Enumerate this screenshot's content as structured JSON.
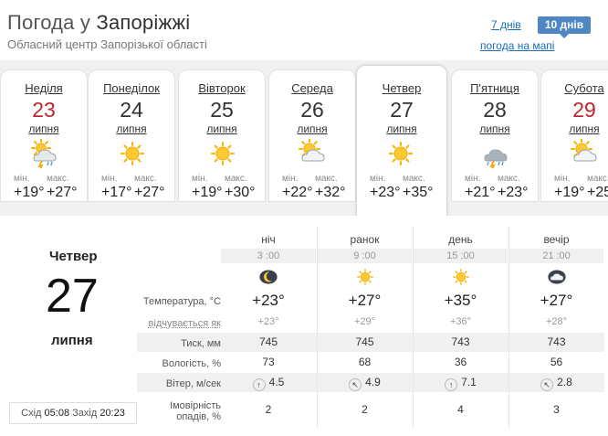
{
  "header": {
    "title_prefix": "Погода у ",
    "title_city": "Запоріжжі",
    "subtitle": "Обласний центр Запорізької області",
    "nav_7days": "7 днів",
    "nav_10days": "10 днів",
    "nav_map": "погода на мапі"
  },
  "days": [
    {
      "name": "Неділя",
      "num": "23",
      "month": "липня",
      "weekend": true,
      "icon": "storm-icon",
      "min_label": "мін.",
      "max_label": "макс.",
      "min": "+19°",
      "max": "+27°"
    },
    {
      "name": "Понеділок",
      "num": "24",
      "month": "липня",
      "weekend": false,
      "icon": "sun-icon",
      "min_label": "мін.",
      "max_label": "макс.",
      "min": "+17°",
      "max": "+27°"
    },
    {
      "name": "Вівторок",
      "num": "25",
      "month": "липня",
      "weekend": false,
      "icon": "sun-icon",
      "min_label": "мін.",
      "max_label": "макс.",
      "min": "+19°",
      "max": "+30°"
    },
    {
      "name": "Середа",
      "num": "26",
      "month": "липня",
      "weekend": false,
      "icon": "partly-cloudy-icon",
      "min_label": "мін.",
      "max_label": "макс.",
      "min": "+22°",
      "max": "+32°"
    },
    {
      "name": "Четвер",
      "num": "27",
      "month": "липня",
      "weekend": false,
      "icon": "sun-icon",
      "min_label": "мін.",
      "max_label": "макс.",
      "min": "+23°",
      "max": "+35°",
      "active": true
    },
    {
      "name": "П'ятниця",
      "num": "28",
      "month": "липня",
      "weekend": false,
      "icon": "thunderstorm-icon",
      "min_label": "мін.",
      "max_label": "макс.",
      "min": "+21°",
      "max": "+23°"
    },
    {
      "name": "Субота",
      "num": "29",
      "month": "липня",
      "weekend": true,
      "icon": "partly-cloudy-icon",
      "min_label": "мін.",
      "max_label": "макс.",
      "min": "+19°",
      "max": "+25"
    }
  ],
  "detail": {
    "day_name": "Четвер",
    "day_num": "27",
    "month": "липня",
    "sunrise_label": "Схід",
    "sunrise": "05:08",
    "sunset_label": "Захід",
    "sunset": "20:23",
    "row_labels": {
      "temp": "Температура, °C",
      "feels": "відчувається як",
      "pressure": "Тиск, мм",
      "humidity": "Вологість, %",
      "wind": "Вітер, м/сек",
      "precip_1": "Імовірність",
      "precip_2": "опадів, %"
    },
    "periods": [
      {
        "name": "ніч",
        "time": "3 :00",
        "icon": "moon-icon",
        "temp": "+23°",
        "feels": "+23°",
        "pressure": "745",
        "humidity": "73",
        "wind_dir": "↑",
        "wind": "4.5",
        "precip": "2"
      },
      {
        "name": "ранок",
        "time": "9 :00",
        "icon": "sun-icon",
        "temp": "+27°",
        "feels": "+29°",
        "pressure": "745",
        "humidity": "68",
        "wind_dir": "↖",
        "wind": "4.9",
        "precip": "2"
      },
      {
        "name": "день",
        "time": "15 :00",
        "icon": "sun-icon",
        "temp": "+35°",
        "feels": "+36°",
        "pressure": "743",
        "humidity": "36",
        "wind_dir": "↑",
        "wind": "7.1",
        "precip": "4"
      },
      {
        "name": "вечір",
        "time": "21 :00",
        "icon": "moon-cloud-icon",
        "temp": "+27°",
        "feels": "+28°",
        "pressure": "743",
        "humidity": "56",
        "wind_dir": "↖",
        "wind": "2.8",
        "precip": "3"
      }
    ]
  },
  "colors": {
    "weekend": "#c0242c",
    "accent": "#4f87c5",
    "link": "#1a6db5"
  }
}
